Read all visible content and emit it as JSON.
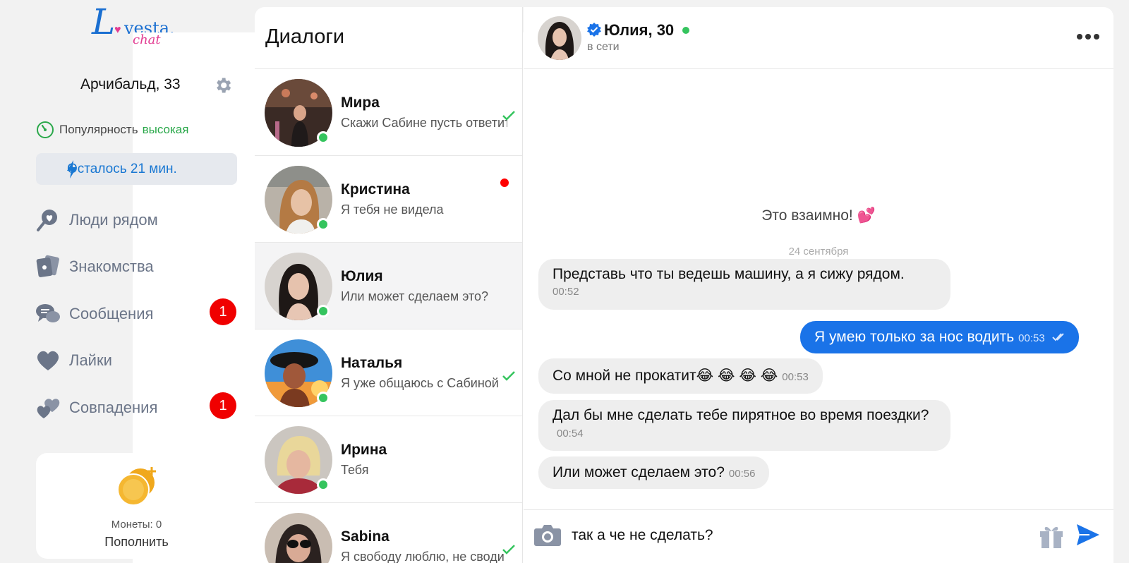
{
  "sidebar": {
    "logo": {
      "l": "L",
      "vesta": "vesta.",
      "chat": "chat"
    },
    "username": "Арчибальд, 33",
    "popularity_label": "Популярность",
    "popularity_value": "высокая",
    "timer": "Осталось 21 мин.",
    "nav": [
      {
        "label": "Люди рядом",
        "icon": "people-nearby-icon"
      },
      {
        "label": "Знакомства",
        "icon": "cards-icon"
      },
      {
        "label": "Сообщения",
        "icon": "chat-bubbles-icon",
        "badge": "1"
      },
      {
        "label": "Лайки",
        "icon": "heart-icon"
      },
      {
        "label": "Совпадения",
        "icon": "two-hearts-icon",
        "badge": "1"
      }
    ],
    "coins_label": "Монеты: 0",
    "topup": "Пополнить"
  },
  "dialogs": {
    "title": "Диалоги",
    "items": [
      {
        "name": "Мира",
        "message": "Скажи Сабине пусть ответит",
        "status": "read"
      },
      {
        "name": "Кристина",
        "message": "Я тебя не видела",
        "status": "unread"
      },
      {
        "name": "Юлия",
        "message": "Или может сделаем это?",
        "status": "active"
      },
      {
        "name": "Наталья",
        "message": "Я уже общаюсь с Сабиной",
        "status": "read"
      },
      {
        "name": "Ирина",
        "message": "Тебя",
        "status": ""
      },
      {
        "name": "Sabina",
        "message": "Я свободу люблю, не своди",
        "status": "read"
      }
    ]
  },
  "chat": {
    "name": "Юлия, 30",
    "status": "в сети",
    "match_text": "Это взаимно! 💕",
    "date": "24 сентября",
    "messages": [
      {
        "text": "Представь что ты ведешь машину, а я сижу рядом.",
        "time": "00:52",
        "dir": "in"
      },
      {
        "text": "Я умею только за нос водить",
        "time": "00:53",
        "dir": "out"
      },
      {
        "text": "Со мной не прокатит😂 😂 😂 😂",
        "time": "00:53",
        "dir": "in"
      },
      {
        "text": "Дал бы мне сделать тебе пирятное во время поездки?",
        "time": "00:54",
        "dir": "in"
      },
      {
        "text": "Или может сделаем это?",
        "time": "00:56",
        "dir": "in"
      }
    ],
    "input_value": "так а че не сделать?"
  },
  "colors": {
    "accent": "#1a73e8",
    "online": "#35c45e",
    "badge": "#f00000",
    "nav": "#6b7588"
  }
}
